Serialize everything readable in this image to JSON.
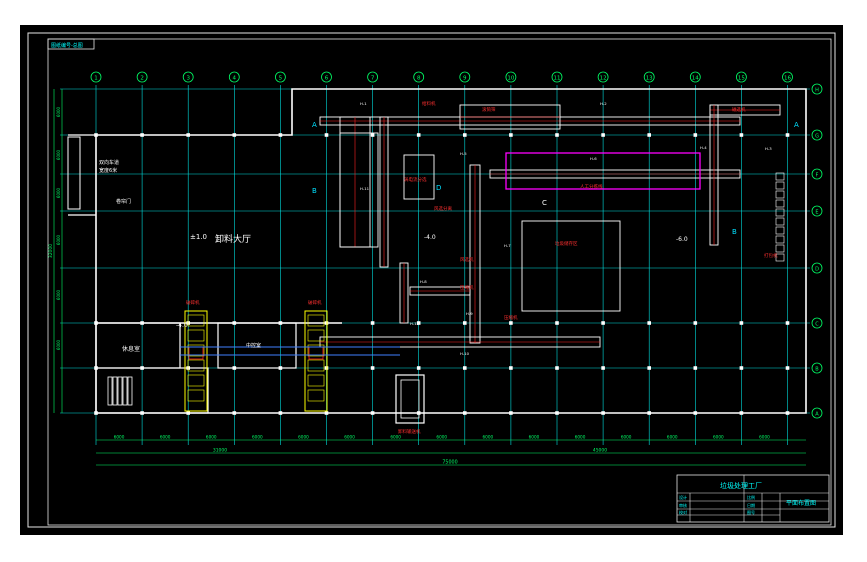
{
  "drawing": {
    "sheet_tag": "图纸编号-总图",
    "columns": [
      "1",
      "2",
      "3",
      "4",
      "5",
      "6",
      "7",
      "8",
      "9",
      "10",
      "11",
      "12",
      "13",
      "14",
      "15",
      "16"
    ],
    "rows": [
      "A",
      "B",
      "C",
      "D",
      "E",
      "F",
      "G",
      "H"
    ],
    "spacings_bottom": [
      "6000",
      "6000",
      "6000",
      "6000",
      "6000",
      "6000",
      "6000",
      "6000",
      "6000",
      "6000",
      "6000",
      "6000",
      "6000",
      "6000",
      "6000",
      "6000"
    ],
    "subtotal_left": "31000",
    "subtotal_right": "45000",
    "total_length": "75000",
    "left_dims": [
      "6000",
      "6000",
      "6000",
      "6000",
      "6000",
      "6000"
    ],
    "left_total": "32000",
    "rooms": {
      "hall": "卸料大厅",
      "hall_elev": "±1.0",
      "office": "休息室",
      "control": "中控室",
      "door_note_1": "双向车道",
      "door_note_2": "宽度6米",
      "roller_door": "卷帘门",
      "storage": "垃圾储存区",
      "bale": "打包机",
      "elev_a": "-4.0",
      "elev_b": "-6.0",
      "elev_c": "-4.0",
      "label_b": "B",
      "label_d": "D",
      "label_b2": "B",
      "label_a": "A",
      "label_a2": "A",
      "label_c": "C"
    },
    "equipment": {
      "feeder": "给料机",
      "trommel": "滚筒筛",
      "manual_sort": "人工分拣线",
      "magnet": "磁选机",
      "crusher_1": "破碎机",
      "crusher_2": "破碎机",
      "eddy": "涡电流分选",
      "air_sep": "风选分离",
      "wind_sort": "风选机",
      "press_1": "压缩机",
      "press_2": "压缩机",
      "dump": "卸料输送机",
      "belts": [
        "H-1",
        "H-2",
        "H-3",
        "H-4",
        "H-5",
        "H-6",
        "H-7",
        "H-8",
        "H-9",
        "H-10",
        "H-11",
        "H-12"
      ]
    },
    "title_block": {
      "project": "垃圾处理工厂",
      "drawing_name": "平面布置图",
      "rows": [
        "设计",
        "审核",
        "校对",
        "比例",
        "日期",
        "图号"
      ]
    }
  }
}
